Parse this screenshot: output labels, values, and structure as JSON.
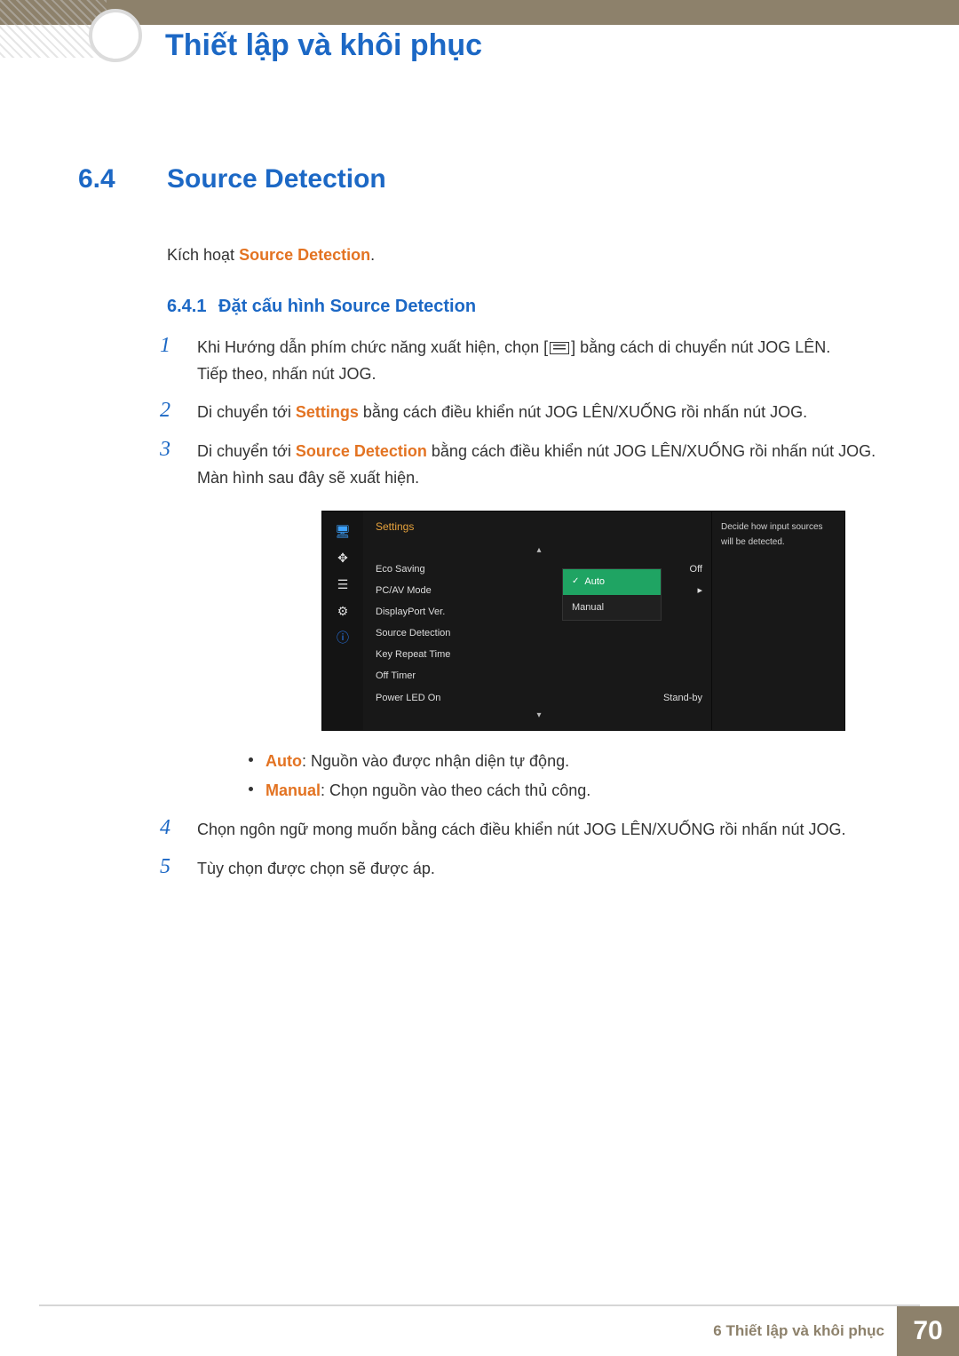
{
  "header": {
    "chapter_title": "Thiết lập và khôi phục"
  },
  "section": {
    "number": "6.4",
    "title": "Source Detection",
    "intro_prefix": "Kích hoạt ",
    "intro_strong": "Source Detection",
    "intro_suffix": "."
  },
  "subsection": {
    "number": "6.4.1",
    "title": "Đặt cấu hình Source Detection"
  },
  "steps": {
    "s1a": "Khi Hướng dẫn phím chức năng xuất hiện, chọn [",
    "s1b": "] bằng cách di chuyển nút JOG LÊN.",
    "s1c": "Tiếp theo, nhấn nút JOG.",
    "s2a": "Di chuyển tới ",
    "s2b": "Settings",
    "s2c": " bằng cách điều khiển nút JOG LÊN/XUỐNG rồi nhấn nút JOG.",
    "s3a": "Di chuyển tới ",
    "s3b": "Source Detection",
    "s3c": " bằng cách điều khiển nút JOG LÊN/XUỐNG rồi nhấn nút JOG.",
    "s3d": "Màn hình sau đây sẽ xuất hiện.",
    "s4": "Chọn ngôn ngữ mong muốn bằng cách điều khiển nút JOG LÊN/XUỐNG rồi nhấn nút JOG.",
    "s5": "Tùy chọn được chọn sẽ được áp."
  },
  "osd": {
    "title": "Settings",
    "rows": [
      {
        "label": "Eco Saving",
        "value": "Off"
      },
      {
        "label": "PC/AV Mode",
        "value": "▸"
      },
      {
        "label": "DisplayPort Ver.",
        "value": ""
      },
      {
        "label": "Source Detection",
        "value": ""
      },
      {
        "label": "Key Repeat Time",
        "value": ""
      },
      {
        "label": "Off Timer",
        "value": ""
      },
      {
        "label": "Power LED On",
        "value": "Stand-by"
      }
    ],
    "popup": [
      "Auto",
      "Manual"
    ],
    "help": "Decide how input sources will be detected."
  },
  "bullets": {
    "auto_label": "Auto",
    "auto_text": ": Nguồn vào được nhận diện tự động.",
    "manual_label": "Manual",
    "manual_text": ": Chọn nguồn vào theo cách thủ công."
  },
  "footer": {
    "text": "6 Thiết lập và khôi phục",
    "page": "70"
  }
}
